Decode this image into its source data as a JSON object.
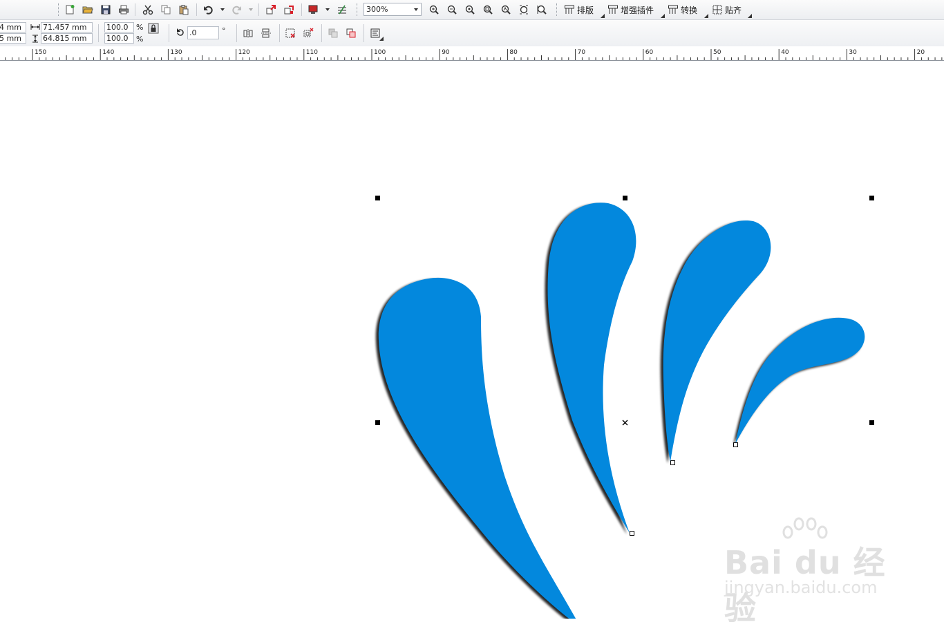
{
  "toolbar": {
    "zoom_value": "300%",
    "menus": [
      {
        "label": "排版",
        "icon": "layout-icon"
      },
      {
        "label": "增强插件",
        "icon": "plugin-icon"
      },
      {
        "label": "转换",
        "icon": "convert-icon"
      },
      {
        "label": "贴齐",
        "icon": "snap-icon"
      }
    ]
  },
  "property_bar": {
    "pos_x": "4 mm",
    "pos_y": "5 mm",
    "width": "71.457 mm",
    "height": "64.815 mm",
    "scale_x": "100.0",
    "scale_y": "100.0",
    "percent_sign": "%",
    "rotation": ".0",
    "degree_sign": "°"
  },
  "ruler": {
    "labels": [
      "150",
      "140",
      "130",
      "120",
      "110",
      "100",
      "90",
      "80",
      "70",
      "60",
      "50",
      "40",
      "30",
      "20"
    ]
  },
  "watermark": {
    "brand": "Bai du 经验",
    "url": "jingyan.baidu.com"
  },
  "colors": {
    "shape_fill": "#0388dd",
    "shadow": "#000000",
    "accent": "#d8202a"
  }
}
